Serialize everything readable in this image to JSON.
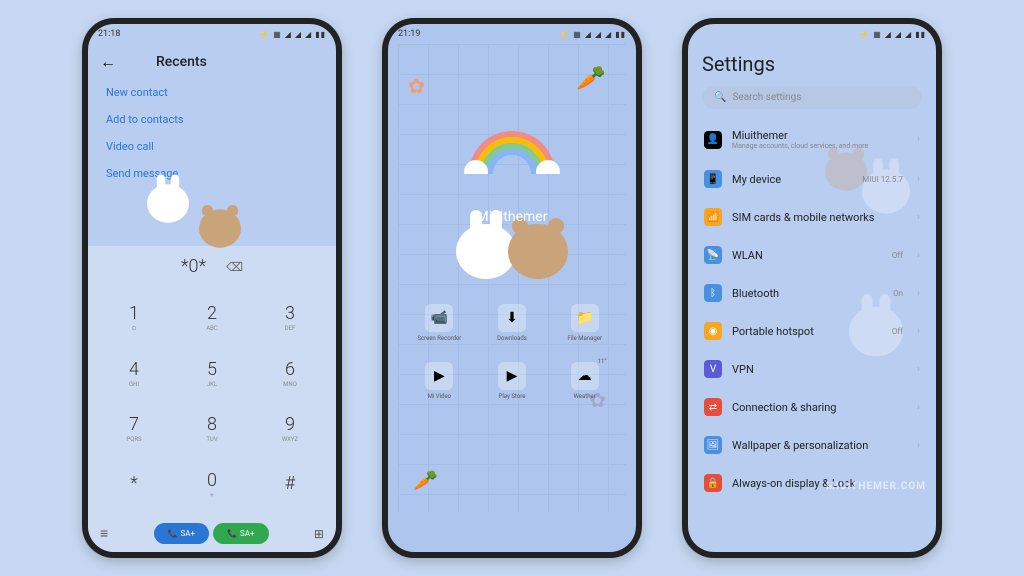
{
  "phone1": {
    "statusTime": "21:18",
    "statusIcons": "⚡ ▦ ◢ ◢ ◢ ▮▮",
    "headerTitle": "Recents",
    "menuLinks": [
      "New contact",
      "Add to contacts",
      "Video call",
      "Send message"
    ],
    "dialedNumber": "*0*",
    "keys": [
      {
        "num": "1",
        "sub": "⊙"
      },
      {
        "num": "2",
        "sub": "ABC"
      },
      {
        "num": "3",
        "sub": "DEF"
      },
      {
        "num": "4",
        "sub": "GHI"
      },
      {
        "num": "5",
        "sub": "JKL"
      },
      {
        "num": "6",
        "sub": "MNO"
      },
      {
        "num": "7",
        "sub": "PQRS"
      },
      {
        "num": "8",
        "sub": "TUV"
      },
      {
        "num": "9",
        "sub": "WXYZ"
      },
      {
        "num": "*",
        "sub": ""
      },
      {
        "num": "0",
        "sub": "+"
      },
      {
        "num": "#",
        "sub": ""
      }
    ],
    "callBtn1": "SA+",
    "callBtn2": "SA+"
  },
  "phone2": {
    "statusTime": "21:19",
    "statusIcons": "⚡ ▦ ◢ ◢ ◢ ▮▮",
    "themeLabel": "Miuithemer",
    "apps": [
      {
        "label": "Screen Recorder",
        "icon": "📹"
      },
      {
        "label": "Downloads",
        "icon": "⬇"
      },
      {
        "label": "File Manager",
        "icon": "📁"
      },
      {
        "label": "Mi Video",
        "icon": "▶"
      },
      {
        "label": "Play Store",
        "icon": "▶"
      },
      {
        "label": "Weather",
        "icon": "☁",
        "badge": "11°"
      }
    ]
  },
  "phone3": {
    "statusTime": "",
    "statusIcons": "⚡ ▦ ◢ ◢ ◢ ▮▮",
    "title": "Settings",
    "searchPlaceholder": "Search settings",
    "items": [
      {
        "icon": "👤",
        "iconBg": "#000",
        "label": "Miuithemer",
        "sub": "Manage accounts, cloud services, and more",
        "value": ""
      },
      {
        "icon": "📱",
        "iconBg": "#4a90e2",
        "label": "My device",
        "sub": "",
        "value": "MIUI 12.5.7"
      },
      {
        "icon": "📶",
        "iconBg": "#f5a623",
        "label": "SIM cards & mobile networks",
        "sub": "",
        "value": ""
      },
      {
        "icon": "📡",
        "iconBg": "#4a90e2",
        "label": "WLAN",
        "sub": "",
        "value": "Off"
      },
      {
        "icon": "ᛒ",
        "iconBg": "#4a90e2",
        "label": "Bluetooth",
        "sub": "",
        "value": "On"
      },
      {
        "icon": "◉",
        "iconBg": "#f5a623",
        "label": "Portable hotspot",
        "sub": "",
        "value": "Off"
      },
      {
        "icon": "V",
        "iconBg": "#5b5bd6",
        "label": "VPN",
        "sub": "",
        "value": ""
      },
      {
        "icon": "⇄",
        "iconBg": "#e74c3c",
        "label": "Connection & sharing",
        "sub": "",
        "value": ""
      },
      {
        "icon": "🖼",
        "iconBg": "#4a90e2",
        "label": "Wallpaper & personalization",
        "sub": "",
        "value": ""
      },
      {
        "icon": "🔒",
        "iconBg": "#e74c3c",
        "label": "Always-on display & Lock",
        "sub": "",
        "value": ""
      }
    ],
    "watermark": "MIUITHEMER.COM"
  }
}
